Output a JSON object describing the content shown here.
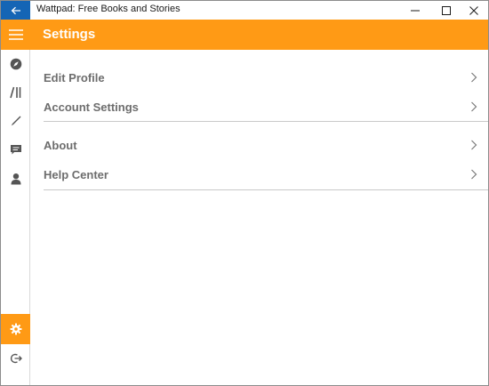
{
  "window": {
    "title": "Wattpad: Free Books and Stories"
  },
  "header": {
    "title": "Settings"
  },
  "rail": {
    "items": [
      {
        "icon": "compass-icon"
      },
      {
        "icon": "library-icon"
      },
      {
        "icon": "pencil-icon"
      },
      {
        "icon": "messages-icon"
      },
      {
        "icon": "profile-icon"
      }
    ],
    "bottom": [
      {
        "icon": "gear-icon",
        "active": true
      },
      {
        "icon": "logout-icon"
      }
    ]
  },
  "settings": {
    "group1": [
      {
        "label": "Edit Profile"
      },
      {
        "label": "Account Settings"
      }
    ],
    "group2": [
      {
        "label": "About"
      },
      {
        "label": "Help Center"
      }
    ]
  },
  "colors": {
    "accent": "#ff9a15",
    "titlebar_back": "#1565b5",
    "label": "#6d6d6d"
  }
}
